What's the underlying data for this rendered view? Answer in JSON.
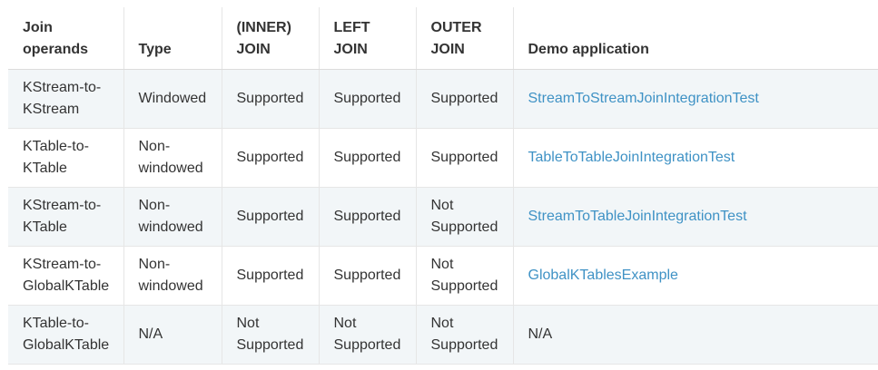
{
  "headers": [
    {
      "line1": "Join",
      "line2": "operands"
    },
    {
      "line1": "",
      "line2": "Type"
    },
    {
      "line1": "(INNER)",
      "line2": "JOIN"
    },
    {
      "line1": "LEFT",
      "line2": "JOIN"
    },
    {
      "line1": "OUTER",
      "line2": "JOIN"
    },
    {
      "line1": "",
      "line2": "Demo application"
    }
  ],
  "rows": [
    {
      "operands": [
        "KStream-to-",
        "KStream"
      ],
      "type": [
        "Windowed"
      ],
      "inner": [
        "Supported"
      ],
      "left": [
        "Supported"
      ],
      "outer": [
        "Supported"
      ],
      "demo": "StreamToStreamJoinIntegrationTest",
      "demo_is_link": true
    },
    {
      "operands": [
        "KTable-to-",
        "KTable"
      ],
      "type": [
        "Non-",
        "windowed"
      ],
      "inner": [
        "Supported"
      ],
      "left": [
        "Supported"
      ],
      "outer": [
        "Supported"
      ],
      "demo": "TableToTableJoinIntegrationTest",
      "demo_is_link": true
    },
    {
      "operands": [
        "KStream-to-",
        "KTable"
      ],
      "type": [
        "Non-",
        "windowed"
      ],
      "inner": [
        "Supported"
      ],
      "left": [
        "Supported"
      ],
      "outer": [
        "Not",
        "Supported"
      ],
      "demo": "StreamToTableJoinIntegrationTest",
      "demo_is_link": true
    },
    {
      "operands": [
        "KStream-to-",
        "GlobalKTable"
      ],
      "type": [
        "Non-",
        "windowed"
      ],
      "inner": [
        "Supported"
      ],
      "left": [
        "Supported"
      ],
      "outer": [
        "Not",
        "Supported"
      ],
      "demo": "GlobalKTablesExample",
      "demo_is_link": true
    },
    {
      "operands": [
        "KTable-to-",
        "GlobalKTable"
      ],
      "type": [
        "N/A"
      ],
      "inner": [
        "Not",
        "Supported"
      ],
      "left": [
        "Not",
        "Supported"
      ],
      "outer": [
        "Not",
        "Supported"
      ],
      "demo": "N/A",
      "demo_is_link": false
    }
  ],
  "colors": {
    "text": "#333333",
    "link": "#3f92c5",
    "row_stripe": "#f2f6f8",
    "border": "#e6e6e6"
  }
}
